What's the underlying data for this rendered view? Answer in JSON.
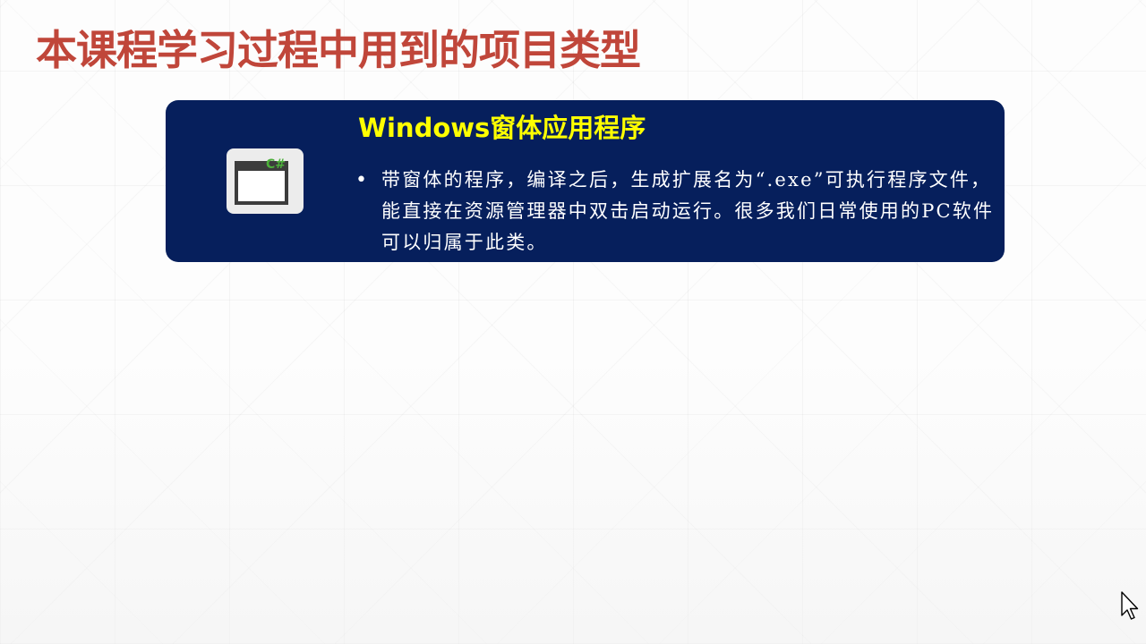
{
  "slide": {
    "title": "本课程学习过程中用到的项目类型"
  },
  "card": {
    "icon": "csharp-window-icon",
    "icon_badge": "C#",
    "heading": "Windows窗体应用程序",
    "bullet_text": "带窗体的程序，编译之后，生成扩展名为“.exe”可执行程序文件，能直接在资源管理器中双击启动运行。很多我们日常使用的PC软件可以归属于此类。",
    "background_color": "#061f5c",
    "heading_color": "#ffff00"
  },
  "colors": {
    "title": "#c0463a",
    "badge": "#4caf3a"
  },
  "cursor": {
    "icon": "mouse-pointer-icon"
  }
}
